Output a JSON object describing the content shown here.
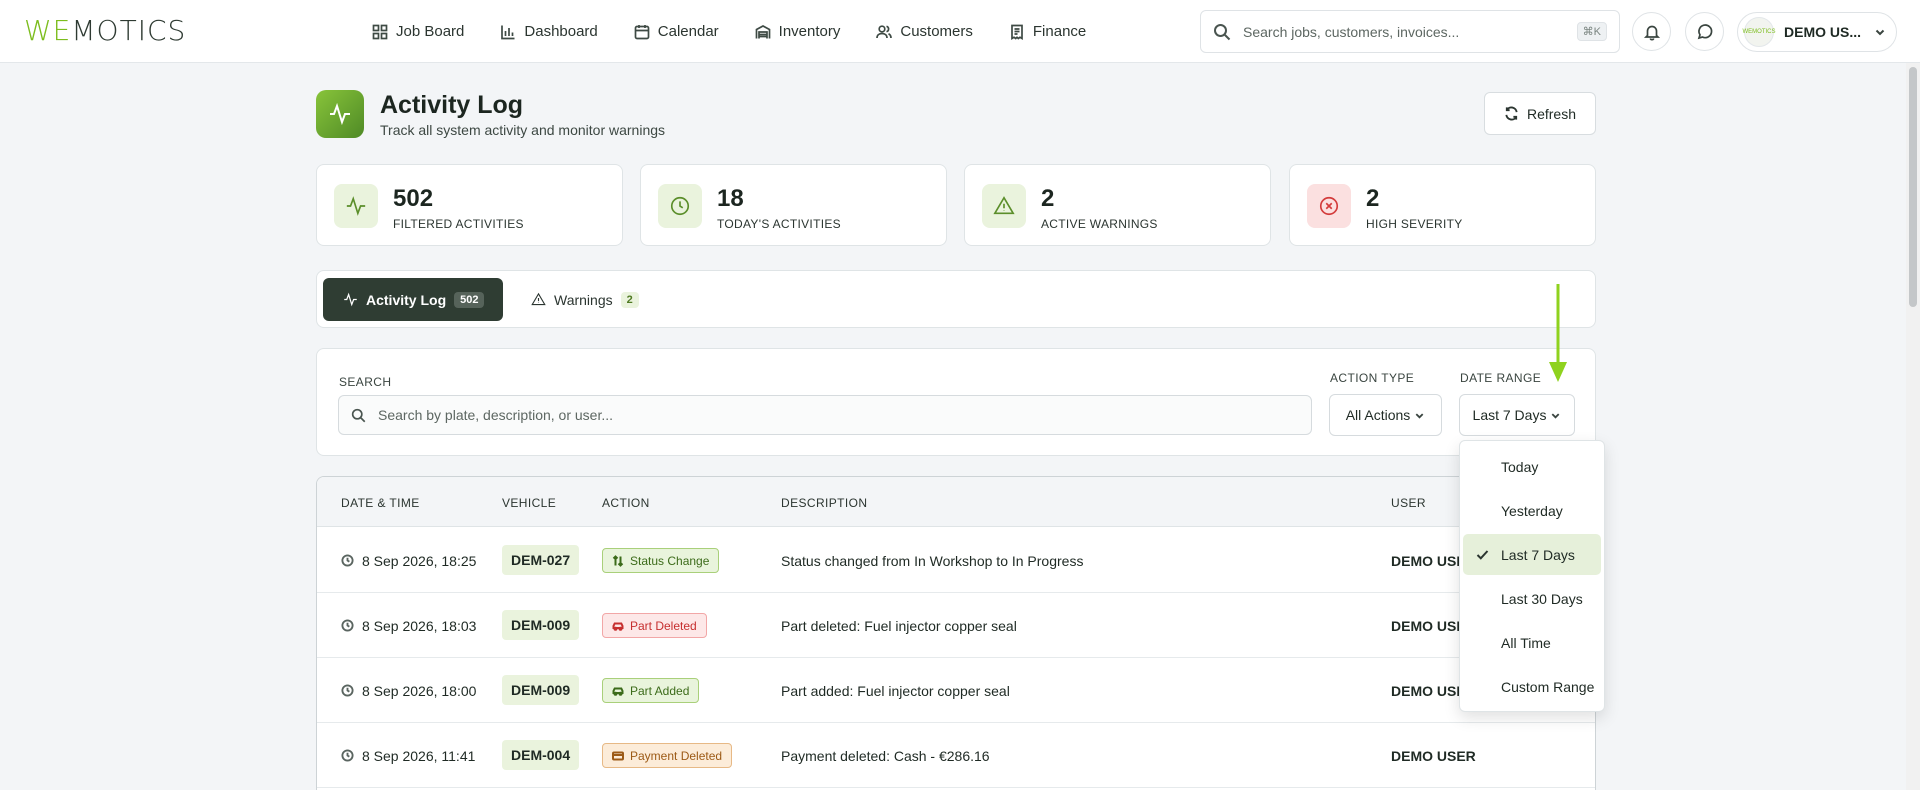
{
  "app": {
    "logo_we": "WE",
    "logo_rest": "MOTICS"
  },
  "nav": [
    {
      "label": "Job Board",
      "icon": "grid-icon"
    },
    {
      "label": "Dashboard",
      "icon": "bar-chart-icon"
    },
    {
      "label": "Calendar",
      "icon": "calendar-icon"
    },
    {
      "label": "Inventory",
      "icon": "warehouse-icon"
    },
    {
      "label": "Customers",
      "icon": "users-icon"
    },
    {
      "label": "Finance",
      "icon": "receipt-icon"
    }
  ],
  "top_search": {
    "placeholder": "Search jobs, customers, invoices...",
    "shortcut": "⌘K"
  },
  "user": {
    "name": "DEMO US...",
    "avatar_text": "WEMOTICS"
  },
  "page": {
    "title": "Activity Log",
    "subtitle": "Track all system activity and monitor warnings",
    "refresh_label": "Refresh"
  },
  "stats": [
    {
      "value": "502",
      "label": "FILTERED ACTIVITIES",
      "icon": "activity-icon",
      "tone": "green"
    },
    {
      "value": "18",
      "label": "TODAY'S ACTIVITIES",
      "icon": "clock-icon",
      "tone": "green"
    },
    {
      "value": "2",
      "label": "ACTIVE WARNINGS",
      "icon": "alert-triangle-icon",
      "tone": "green"
    },
    {
      "value": "2",
      "label": "HIGH SEVERITY",
      "icon": "x-circle-icon",
      "tone": "red"
    }
  ],
  "tabs": {
    "activity": {
      "label": "Activity Log",
      "count": "502"
    },
    "warnings": {
      "label": "Warnings",
      "count": "2"
    }
  },
  "filters": {
    "search_label": "SEARCH",
    "search_placeholder": "Search by plate, description, or user...",
    "action_type_label": "ACTION TYPE",
    "action_type_value": "All Actions",
    "date_range_label": "DATE RANGE",
    "date_range_value": "Last 7 Days"
  },
  "table": {
    "headers": {
      "datetime": "DATE & TIME",
      "vehicle": "VEHICLE",
      "action": "ACTION",
      "description": "DESCRIPTION",
      "user": "USER"
    },
    "rows": [
      {
        "datetime": "8 Sep 2026, 18:25",
        "vehicle": "DEM-027",
        "action": "Status Change",
        "action_tone": "green",
        "description": "Status changed from In Workshop to In Progress",
        "user": "DEMO USER"
      },
      {
        "datetime": "8 Sep 2026, 18:03",
        "vehicle": "DEM-009",
        "action": "Part Deleted",
        "action_tone": "red",
        "description": "Part deleted: Fuel injector copper seal",
        "user": "DEMO USER"
      },
      {
        "datetime": "8 Sep 2026, 18:00",
        "vehicle": "DEM-009",
        "action": "Part Added",
        "action_tone": "green",
        "description": "Part added: Fuel injector copper seal",
        "user": "DEMO USER"
      },
      {
        "datetime": "8 Sep 2026, 11:41",
        "vehicle": "DEM-004",
        "action": "Payment Deleted",
        "action_tone": "orange",
        "description": "Payment deleted: Cash - €286.16",
        "user": "DEMO USER"
      }
    ]
  },
  "date_range_options": [
    {
      "label": "Today",
      "selected": false
    },
    {
      "label": "Yesterday",
      "selected": false
    },
    {
      "label": "Last 7 Days",
      "selected": true
    },
    {
      "label": "Last 30 Days",
      "selected": false
    },
    {
      "label": "All Time",
      "selected": false
    },
    {
      "label": "Custom Range",
      "selected": false
    }
  ],
  "colors": {
    "accent": "#7cbd1d",
    "dark": "#2f3d33",
    "arrow": "#8fd21e"
  }
}
